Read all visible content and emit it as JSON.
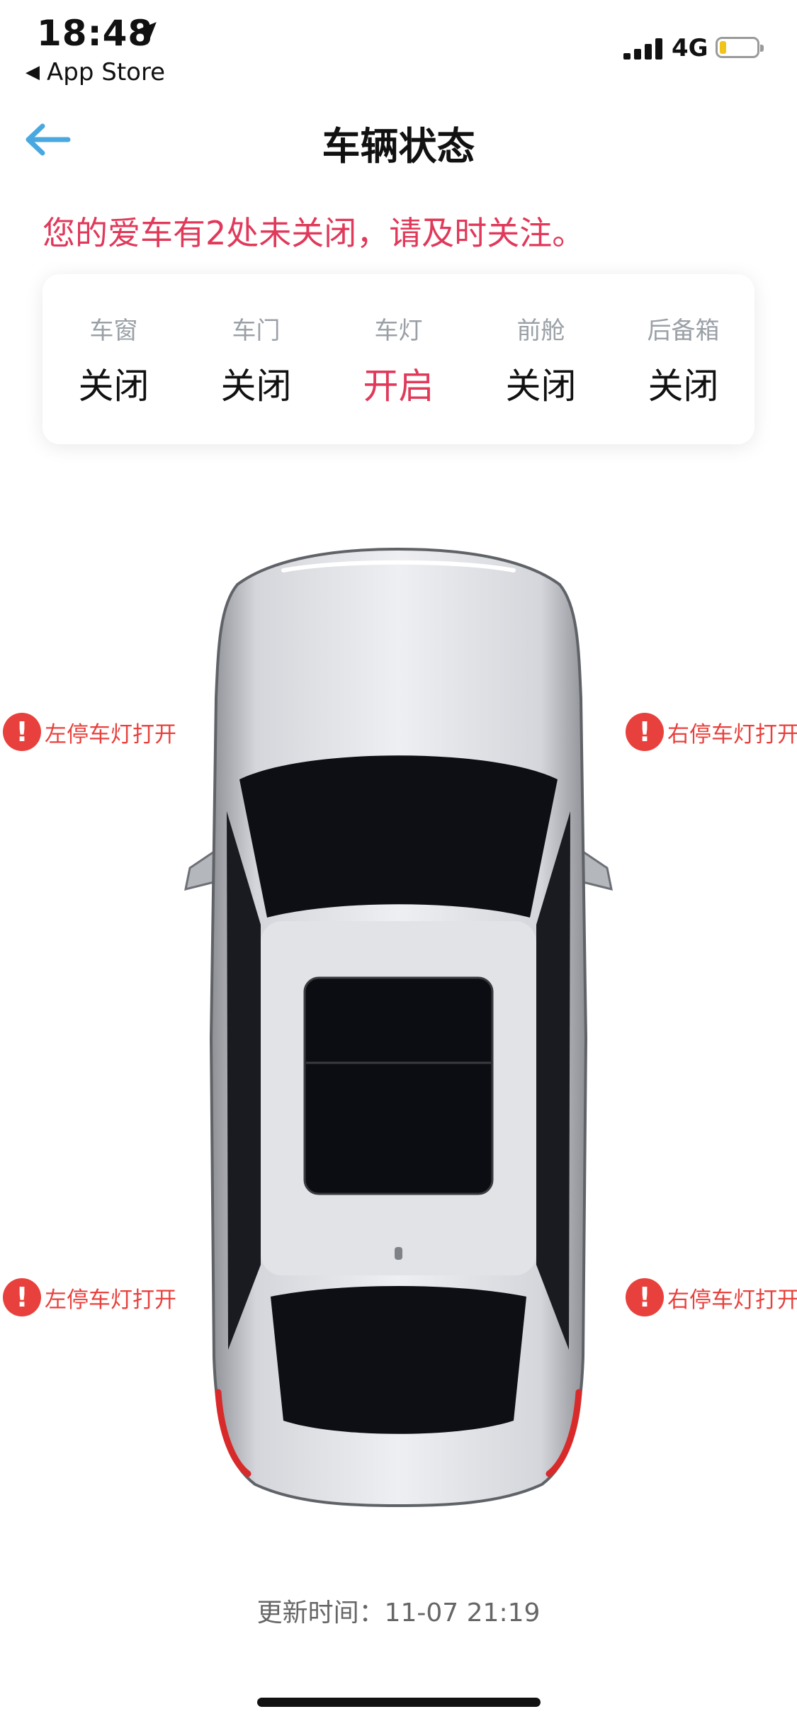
{
  "status_bar": {
    "time": "18:48",
    "back_app": "App Store",
    "network": "4G",
    "location_icon": "location-arrow-icon",
    "battery_icon": "battery-low-icon"
  },
  "header": {
    "title": "车辆状态",
    "back_icon": "arrow-left-icon"
  },
  "alert": "您的爱车有2处未关闭，请及时关注。",
  "status_items": [
    {
      "label": "车窗",
      "value": "关闭",
      "open": false
    },
    {
      "label": "车门",
      "value": "关闭",
      "open": false
    },
    {
      "label": "车灯",
      "value": "开启",
      "open": true
    },
    {
      "label": "前舱",
      "value": "关闭",
      "open": false
    },
    {
      "label": "后备箱",
      "value": "关闭",
      "open": false
    }
  ],
  "warnings": {
    "front_left": "左停车灯打开",
    "front_right": "右停车灯打开",
    "rear_left": "左停车灯打开",
    "rear_right": "右停车灯打开",
    "icon": "!"
  },
  "update_time": "更新时间：11-07 21:19",
  "colors": {
    "accent_red": "#e0395a",
    "warning_red": "#e8413d",
    "back_blue": "#4aa8e0"
  }
}
